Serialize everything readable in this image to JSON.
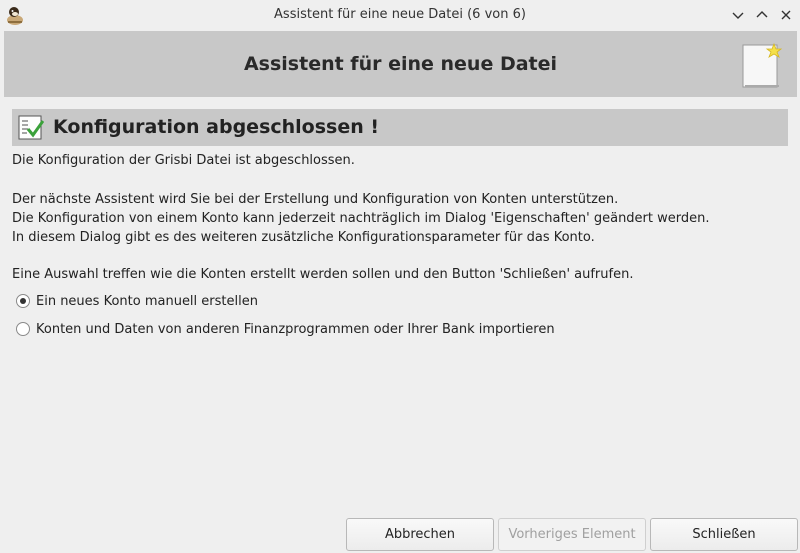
{
  "window": {
    "title": "Assistent für eine neue Datei (6 von 6)",
    "controls": [
      "minimize",
      "maximize",
      "close"
    ]
  },
  "banner": {
    "title": "Assistent für eine neue Datei"
  },
  "section": {
    "title": "Konfiguration abgeschlossen !"
  },
  "body": {
    "line1": "Die Konfiguration der Grisbi Datei ist abgeschlossen.",
    "line2": "Der nächste Assistent wird Sie bei der Erstellung und Konfiguration von Konten unterstützen.",
    "line3": "Die Konfiguration von einem Konto kann jederzeit nachträglich im Dialog 'Eigenschaften' geändert werden.",
    "line4": "In diesem Dialog gibt es des weiteren zusätzliche Konfigurationsparameter für das Konto.",
    "line5": "Eine Auswahl treffen wie die Konten erstellt werden sollen und den Button 'Schließen' aufrufen."
  },
  "options": [
    {
      "label": "Ein neues Konto manuell erstellen",
      "selected": true
    },
    {
      "label": "Konten und Daten von anderen Finanzprogrammen oder Ihrer Bank importieren",
      "selected": false
    }
  ],
  "buttons": {
    "cancel": "Abbrechen",
    "previous": "Vorheriges Element",
    "close": "Schließen"
  },
  "colors": {
    "background": "#efefef",
    "banner": "#c8c8c8",
    "check_green": "#3aa13a",
    "star_yellow": "#f5e04a"
  }
}
